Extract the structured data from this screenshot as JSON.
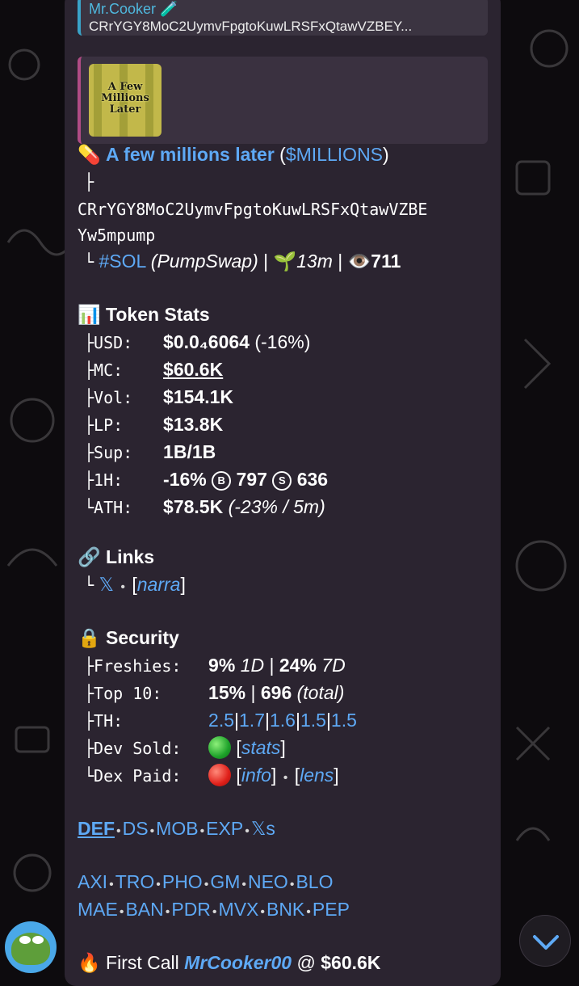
{
  "reply": {
    "author": "Mr.Cooker 🧪",
    "text": "CRrYGY8MoC2UymvFpgtoKuwLRSFxQtawVZBEY..."
  },
  "preview": {
    "image_caption": "A Few Millions Later"
  },
  "token": {
    "emoji": "💊",
    "name": "A few millions later",
    "ticker_open": " (",
    "ticker": "$MILLIONS",
    "ticker_close": ")",
    "address_line1": "CRrYGY8MoC2UymvFpgtoKuwLRSFxQtawVZBE",
    "address_line2": "Yw5mpump",
    "chain_tag": "#SOL",
    "dex": "(PumpSwap)",
    "age_emoji": "🌱",
    "age": "13m",
    "views_emoji": "👁️",
    "views": "711"
  },
  "stats": {
    "header_emoji": "📊",
    "header": "Token Stats",
    "rows": [
      {
        "prefix": "├",
        "label": "USD:",
        "value": "$0.0₄6064",
        "extra": " (-16%)"
      },
      {
        "prefix": "├",
        "label": "MC:",
        "value": "$60.6K"
      },
      {
        "prefix": "├",
        "label": "Vol:",
        "value": "$154.1K"
      },
      {
        "prefix": "├",
        "label": "LP:",
        "value": "$13.8K"
      },
      {
        "prefix": "├",
        "label": "Sup:",
        "value": "1B/1B"
      },
      {
        "prefix": "├",
        "label": "1H:",
        "value": "-16%",
        "buy_icon": "B",
        "buys": "797",
        "sell_icon": "S",
        "sells": "636"
      },
      {
        "prefix": "└",
        "label": "ATH:",
        "value": "$78.5K",
        "extra": "(-23% / 5m)"
      }
    ]
  },
  "links": {
    "header_emoji": "🔗",
    "header": "Links",
    "prefix": "└",
    "x_label": "𝕏",
    "narra_label": "narra"
  },
  "security": {
    "header_emoji": "🔒",
    "header": "Security",
    "freshies_label": "Freshies:",
    "freshies_1d": "9%",
    "freshies_1d_unit": "1D",
    "freshies_7d": "24%",
    "freshies_7d_unit": "7D",
    "top10_label": "Top 10:",
    "top10_pct": "15%",
    "top10_holders": "696",
    "top10_unit": "(total)",
    "th_label": "TH:",
    "th_values": [
      "2.5",
      "1.7",
      "1.6",
      "1.5",
      "1.5"
    ],
    "dev_sold_label": "Dev Sold:",
    "dev_sold_status": "green-circle",
    "dev_sold_link": "stats",
    "dex_paid_label": "Dex Paid:",
    "dex_paid_status": "red-circle",
    "dex_paid_link1": "info",
    "dex_paid_link2": "lens"
  },
  "quick_links_row1": [
    "DEF",
    "DS",
    "MOB",
    "EXP",
    "𝕏s"
  ],
  "platforms_row1": [
    "AXI",
    "TRO",
    "PHO",
    "GM",
    "NEO",
    "BLO"
  ],
  "platforms_row2": [
    "MAE",
    "BAN",
    "PDR",
    "MVX",
    "BNK",
    "PEP"
  ],
  "first_call": {
    "emoji": "🔥",
    "label": "First Call",
    "user": "MrCooker00",
    "at": "@",
    "mc": "$60.6K"
  },
  "colors": {
    "bubble": "#2b2430",
    "link": "#5ea9f5",
    "reply_accent": "#3aa3c8",
    "preview_accent": "#b04c85"
  }
}
